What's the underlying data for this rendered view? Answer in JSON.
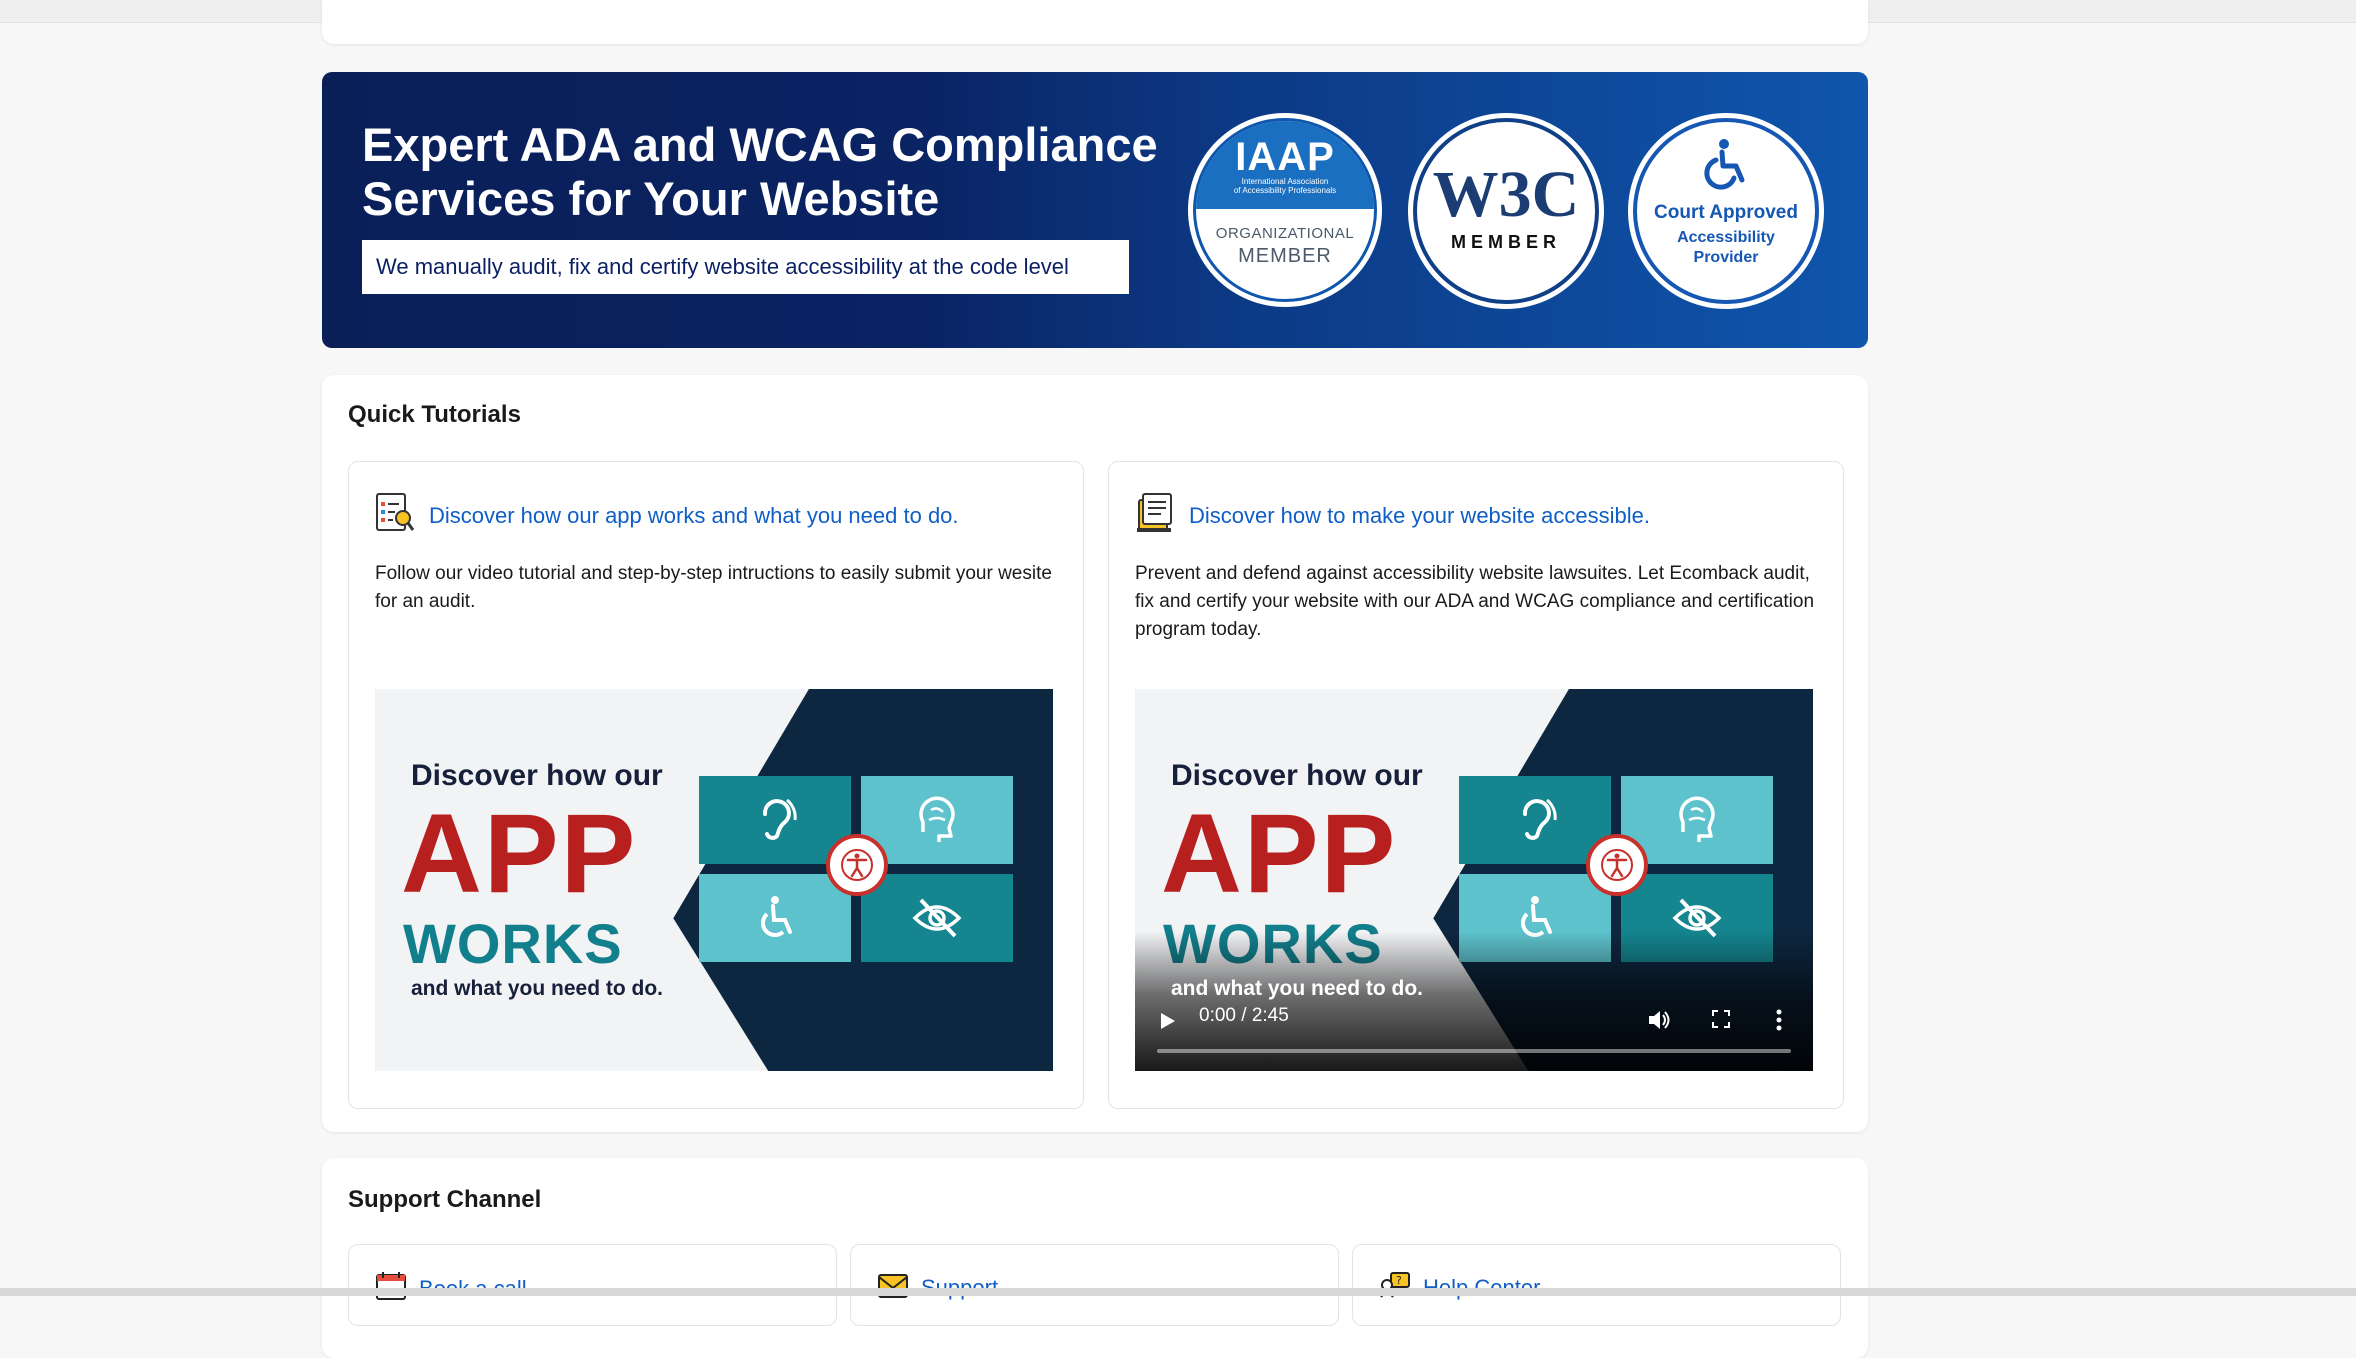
{
  "banner": {
    "title": "Expert ADA and WCAG Compliance Services for Your Website",
    "subtitle": "We manually audit, fix and certify website accessibility at the code level",
    "badges": {
      "iaap_logo": "IAAP",
      "iaap_fullname_1": "International Association",
      "iaap_fullname_2": "of Accessibility Professionals",
      "iaap_org": "ORGANIZATIONAL",
      "iaap_member": "MEMBER",
      "w3c_logo": "W3C",
      "w3c_member": "MEMBER",
      "court_line1": "Court Approved",
      "court_line2": "Accessibility",
      "court_line3": "Provider"
    }
  },
  "tutorials": {
    "title": "Quick Tutorials",
    "items": [
      {
        "link": "Discover how our app works and what you need to do.",
        "description": "Follow our video tutorial and step-by-step intructions to easily submit your wesite for an audit.",
        "thumb": {
          "line1": "Discover how our",
          "line2": "APP",
          "line3": "WORKS",
          "line4": "and what you need to do."
        }
      },
      {
        "link": "Discover how to make your website accessible.",
        "description": "Prevent and defend against accessibility website lawsuites. Let Ecomback audit, fix and certify your website with our ADA and WCAG compliance and certification program today.",
        "thumb": {
          "line1": "Discover how our",
          "line2": "APP",
          "line3": "WORKS",
          "line4": "and what you need to do."
        },
        "video": {
          "time": "0:00 / 2:45",
          "progress": 0
        }
      }
    ]
  },
  "support": {
    "title": "Support Channel",
    "items": [
      {
        "label": "Book a call",
        "icon": "calendar-icon"
      },
      {
        "label": "Support",
        "icon": "envelope-icon"
      },
      {
        "label": "Help Center",
        "icon": "help-icon"
      }
    ]
  },
  "colors": {
    "brand_dark": "#0a1f58",
    "brand_blue": "#0f56ad",
    "link": "#0f5ec7",
    "app_red": "#b8201f",
    "works_teal": "#127f8c"
  }
}
